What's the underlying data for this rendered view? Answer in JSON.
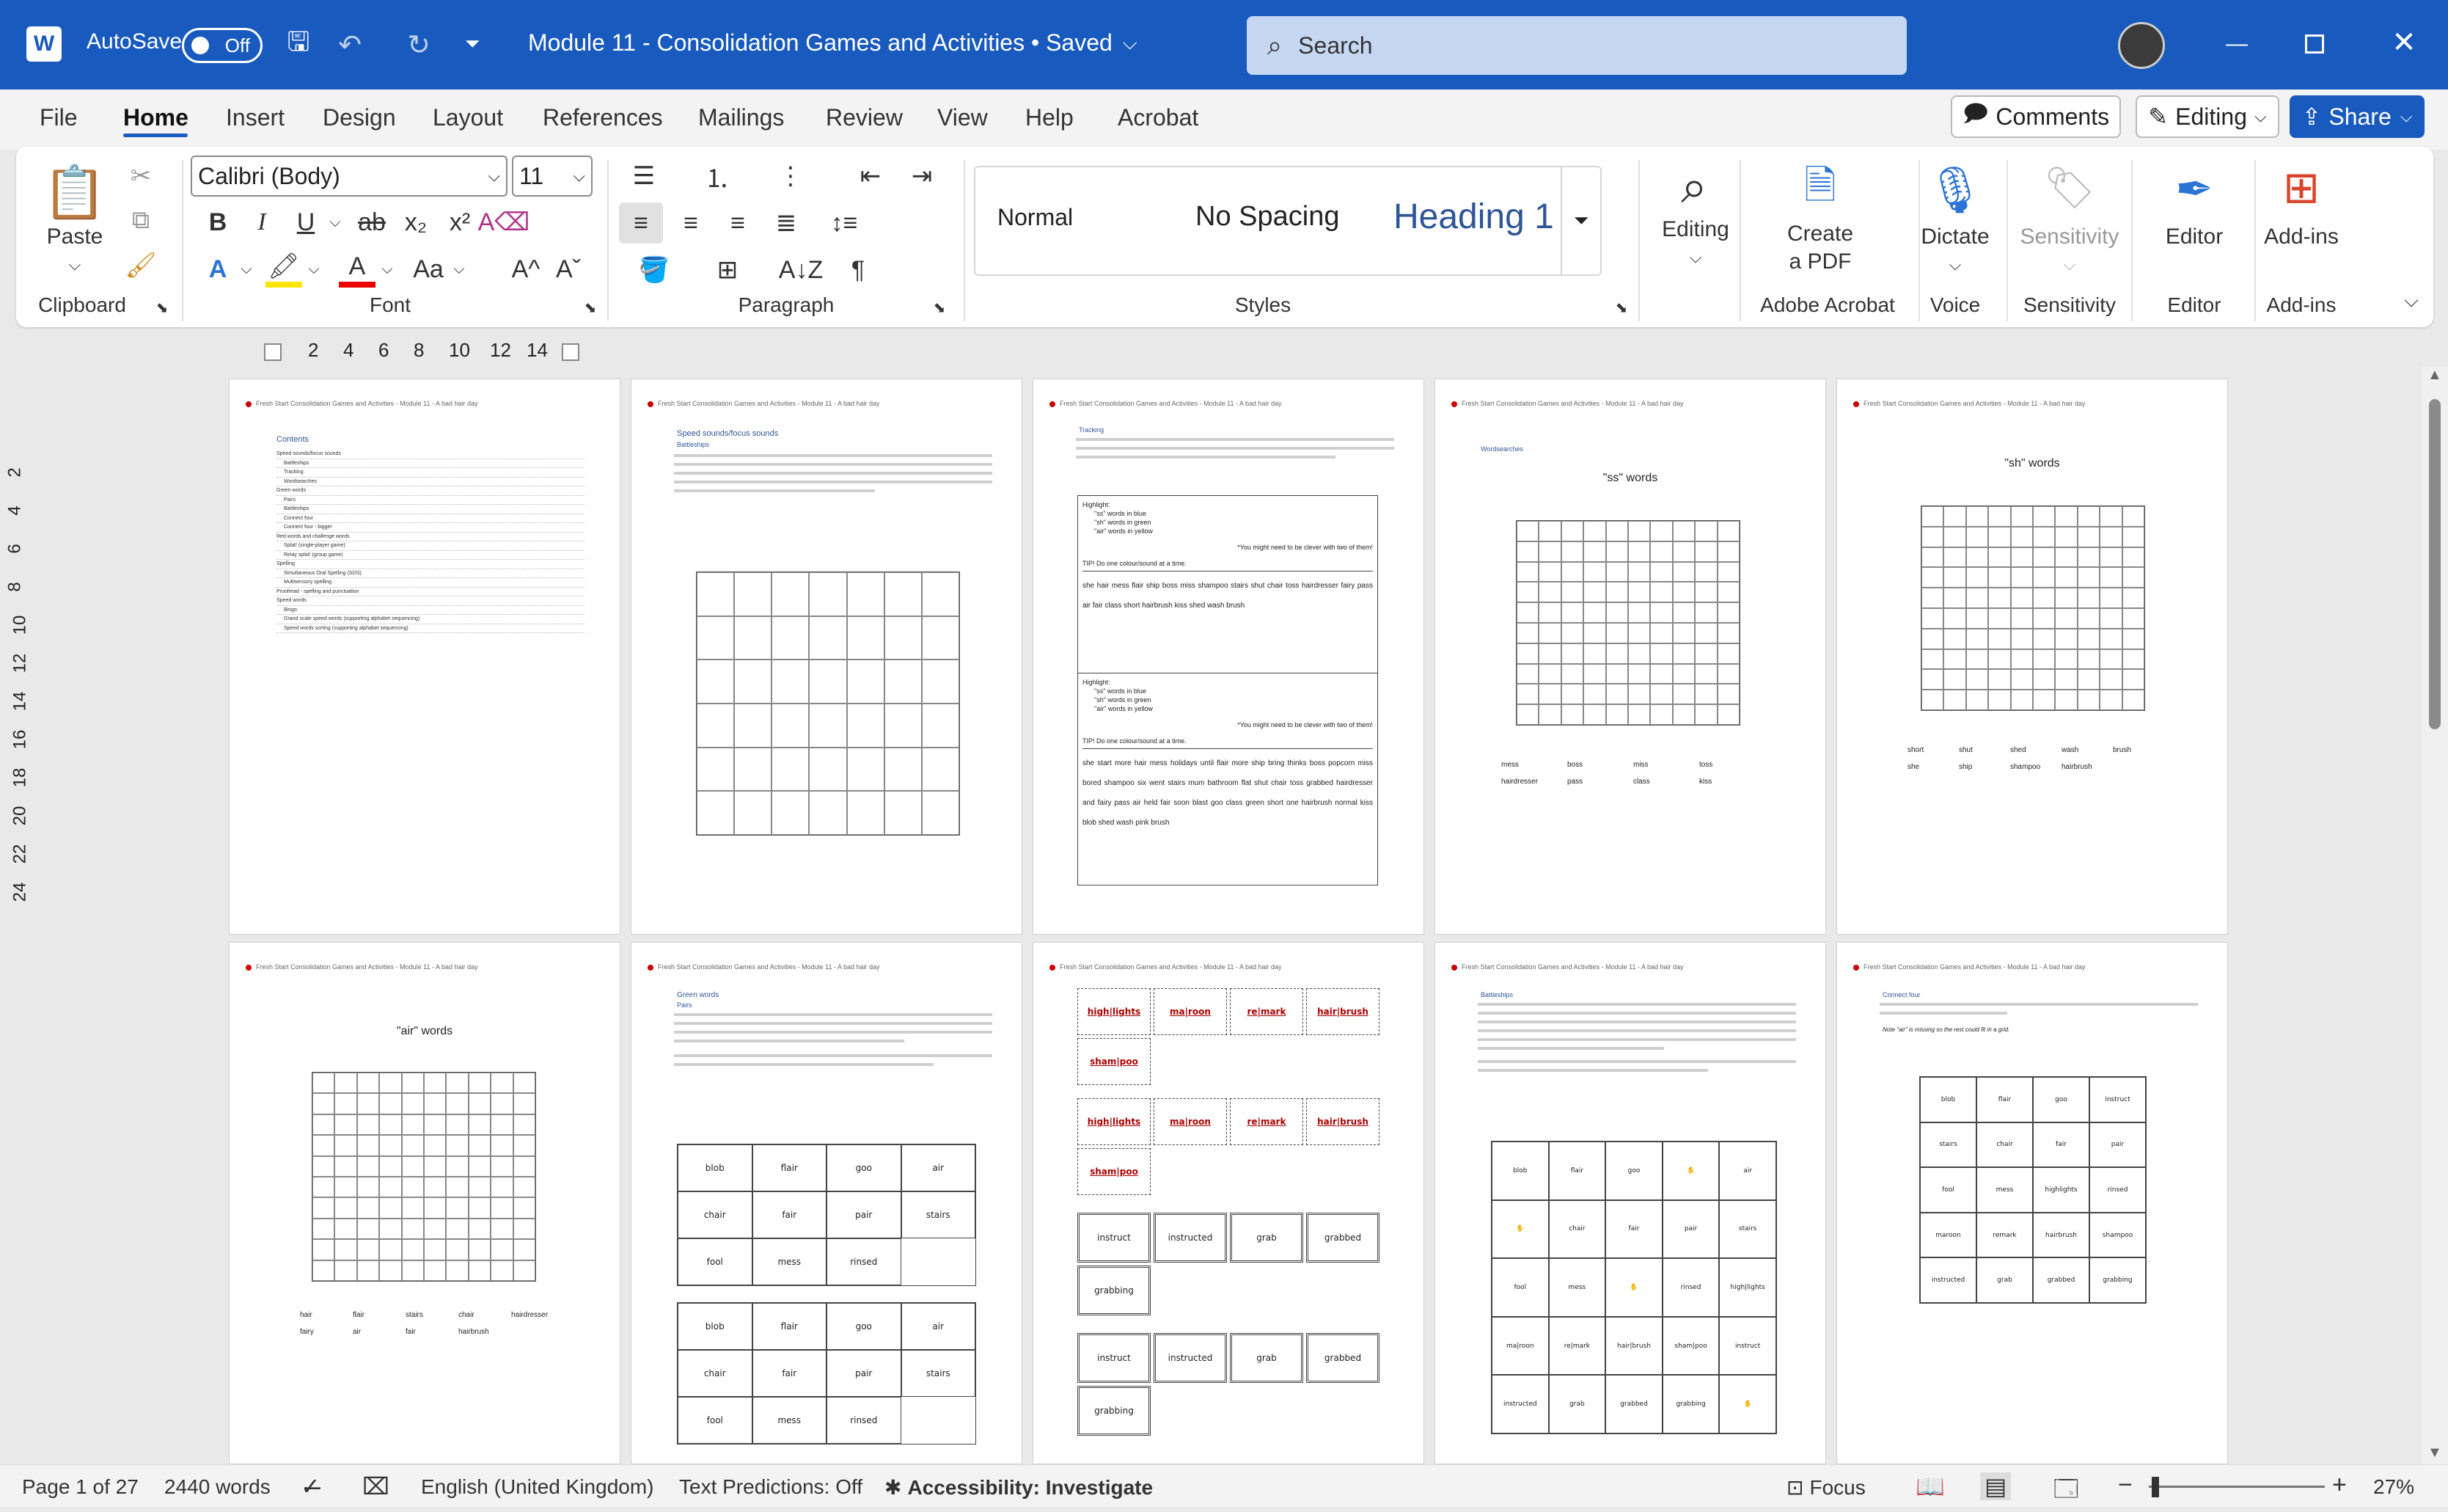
{
  "titlebar": {
    "autosave": "AutoSave",
    "toggle": "Off",
    "doc_title": "Module 11 - Consolidation Games and Activities • Saved",
    "search_placeholder": "Search"
  },
  "tabs": [
    "File",
    "Home",
    "Insert",
    "Design",
    "Layout",
    "References",
    "Mailings",
    "Review",
    "View",
    "Help",
    "Acrobat"
  ],
  "top_right": {
    "comments": "Comments",
    "editing": "Editing",
    "share": "Share"
  },
  "ribbon": {
    "paste": "Paste",
    "font_name": "Calibri (Body)",
    "font_size": "11",
    "styles": [
      "Normal",
      "No Spacing",
      "Heading 1"
    ],
    "editing": "Editing",
    "create_pdf": "Create\na PDF",
    "dictate": "Dictate",
    "sensitivity": "Sensitivity",
    "editor": "Editor",
    "addins": "Add-ins"
  },
  "groups": [
    "Clipboard",
    "Font",
    "Paragraph",
    "Styles",
    "Adobe Acrobat",
    "Voice",
    "Sensitivity",
    "Editor",
    "Add-ins"
  ],
  "ruler_numbers": [
    "2",
    "4",
    "6",
    "8",
    "10",
    "12",
    "14"
  ],
  "vruler_numbers": [
    "2",
    "4",
    "6",
    "8",
    "10",
    "12",
    "14",
    "16",
    "18",
    "20",
    "22",
    "24"
  ],
  "pages": [
    {
      "header": "Fresh Start Consolidation Games and Activities - Module 11 - A bad hair day",
      "title": "Contents",
      "lines": [
        "Speed sounds/focus sounds",
        "Battleships",
        "Tracking",
        "Wordsearches",
        "Green words",
        "Pairs",
        "Battleships",
        "Connect four",
        "Connect four - bigger",
        "Red words and challenge words",
        "Splat! (single-player game)",
        "Relay splat! (group game)",
        "Spelling",
        "Simultaneous Oral Spelling (SOS)",
        "Multisensory spelling",
        "Proofread - spelling and punctuation",
        "Speed words",
        "Bingo",
        "Grand scale speed words (supporting alphabet sequencing)",
        "Speed words sorting (supporting alphabet sequencing)"
      ]
    },
    {
      "header": "Fresh Start Consolidation Games and Activities - Module 11 - A bad hair day",
      "title": "Speed sounds/focus sounds",
      "subtitle": "Battleships"
    },
    {
      "header": "Fresh Start Consolidation Games and Activities - Module 11 - A bad hair day",
      "title": "Tracking",
      "box1": [
        "Highlight:",
        "\"ss\" words in blue",
        "\"sh\" words in green",
        "\"air\" words in yellow",
        "*You might need to be clever with two of them!",
        "TIP! Do one colour/sound at a time."
      ],
      "words1": "she hair mess flair ship boss miss shampoo stairs shut chair toss hairdresser fairy pass air fair class short hairbrush kiss shed wash brush",
      "words2": "she start more hair mess holidays until flair more ship bring thinks boss popcorn miss bored shampoo six went stairs mum bathroom flat shut chair toss grabbed hairdresser and fairy pass air held fair soon blast goo class green short one hairbrush normal kiss blob shed wash pink brush"
    },
    {
      "header": "Fresh Start Consolidation Games and Activities - Module 11 - A bad hair day",
      "subtitle": "Wordsearches",
      "title": "\"ss\" words",
      "words": [
        "mess",
        "boss",
        "miss",
        "toss",
        "hairdresser",
        "pass",
        "class",
        "kiss"
      ]
    },
    {
      "header": "Fresh Start Consolidation Games and Activities - Module 11 - A bad hair day",
      "title": "\"sh\" words",
      "words": [
        "short",
        "shut",
        "shed",
        "wash",
        "brush",
        "she",
        "ship",
        "shampoo",
        "hairbrush"
      ]
    },
    {
      "header": "Fresh Start Consolidation Games and Activities - Module 11 - A bad hair day",
      "title": "\"air\" words",
      "words": [
        "hair",
        "flair",
        "stairs",
        "chair",
        "hairdresser",
        "fairy",
        "air",
        "fair",
        "hairbrush"
      ]
    },
    {
      "header": "Fresh Start Consolidation Games and Activities - Module 11 - A bad hair day",
      "title": "Green words",
      "subtitle": "Pairs",
      "cards": [
        "blob",
        "flair",
        "goo",
        "air",
        "chair",
        "fair",
        "pair",
        "stairs",
        "fool",
        "mess",
        "rinsed"
      ]
    },
    {
      "header": "Fresh Start Consolidation Games and Activities - Module 11 - A bad hair day",
      "cards1": [
        "high|lights",
        "ma|roon",
        "re|mark",
        "hair|brush",
        "sham|poo"
      ],
      "cards2": [
        "instruct",
        "instructed",
        "grab",
        "grabbed",
        "grabbing"
      ]
    },
    {
      "header": "Fresh Start Consolidation Games and Activities - Module 11 - A bad hair day",
      "title": "Battleships",
      "grid": [
        "blob",
        "flair",
        "goo",
        "✋",
        "air",
        "✋",
        "chair",
        "fair",
        "pair",
        "stairs",
        "fool",
        "mess",
        "✋",
        "rinsed",
        "high|lights",
        "ma|roon",
        "re|mark",
        "hair|brush",
        "sham|poo",
        "instruct",
        "instructed",
        "grab",
        "grabbed",
        "grabbing",
        "✋"
      ]
    },
    {
      "header": "Fresh Start Consolidation Games and Activities - Module 11 - A bad hair day",
      "title": "Connect four",
      "note": "Note \"air\" is missing so the rest could fit in a grid.",
      "grid": [
        "blob",
        "flair",
        "goo",
        "instruct",
        "stairs",
        "chair",
        "fair",
        "pair",
        "fool",
        "mess",
        "highlights",
        "rinsed",
        "maroon",
        "remark",
        "hairbrush",
        "shampoo",
        "instructed",
        "grab",
        "grabbed",
        "grabbing"
      ]
    }
  ],
  "status": {
    "page": "Page 1 of 27",
    "words": "2440 words",
    "language": "English (United Kingdom)",
    "predictions": "Text Predictions: Off",
    "accessibility": "Accessibility: Investigate",
    "focus": "Focus",
    "zoom": "27%"
  }
}
